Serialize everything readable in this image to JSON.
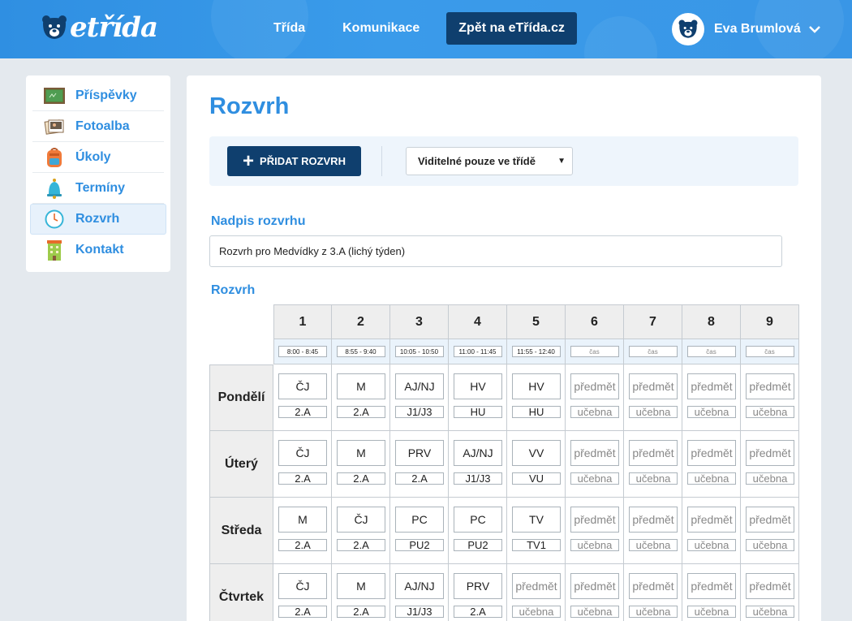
{
  "brand": {
    "logo_text": "etřída"
  },
  "nav": {
    "items": [
      "Třída",
      "Komunikace"
    ],
    "back_label": "Zpět na eTřída.cz"
  },
  "user": {
    "name": "Eva Brumlová"
  },
  "sidebar": {
    "items": [
      {
        "label": "Příspěvky",
        "icon": "board-icon"
      },
      {
        "label": "Fotoalba",
        "icon": "photo-album-icon"
      },
      {
        "label": "Úkoly",
        "icon": "backpack-icon"
      },
      {
        "label": "Termíny",
        "icon": "bell-icon"
      },
      {
        "label": "Rozvrh",
        "icon": "clock-icon",
        "active": true
      },
      {
        "label": "Kontakt",
        "icon": "building-icon"
      }
    ]
  },
  "page": {
    "title": "Rozvrh",
    "add_button": "PŘIDAT ROZVRH",
    "visibility_select": "Viditelné pouze ve třídě",
    "name_label": "Nadpis rozvrhu",
    "name_value": "Rozvrh pro Medvídky z 3.A (lichý týden)",
    "grid_label": "Rozvrh"
  },
  "schedule": {
    "columns": [
      "1",
      "2",
      "3",
      "4",
      "5",
      "6",
      "7",
      "8",
      "9"
    ],
    "times": [
      "8:00 - 8:45",
      "8:55 - 9:40",
      "10:05 - 10:50",
      "11:00 - 11:45",
      "11:55 - 12:40",
      "",
      "",
      "",
      ""
    ],
    "time_placeholder": "čas",
    "subject_placeholder": "předmět",
    "room_placeholder": "učebna",
    "days": [
      {
        "name": "Pondělí",
        "cells": [
          [
            "ČJ",
            "2.A"
          ],
          [
            "M",
            "2.A"
          ],
          [
            "AJ/NJ",
            "J1/J3"
          ],
          [
            "HV",
            "HU"
          ],
          [
            "HV",
            "HU"
          ],
          [
            "",
            ""
          ],
          [
            "",
            ""
          ],
          [
            "",
            ""
          ],
          [
            "",
            ""
          ]
        ]
      },
      {
        "name": "Úterý",
        "cells": [
          [
            "ČJ",
            "2.A"
          ],
          [
            "M",
            "2.A"
          ],
          [
            "PRV",
            "2.A"
          ],
          [
            "AJ/NJ",
            "J1/J3"
          ],
          [
            "VV",
            "VU"
          ],
          [
            "",
            ""
          ],
          [
            "",
            ""
          ],
          [
            "",
            ""
          ],
          [
            "",
            ""
          ]
        ]
      },
      {
        "name": "Středa",
        "cells": [
          [
            "M",
            "2.A"
          ],
          [
            "ČJ",
            "2.A"
          ],
          [
            "PC",
            "PU2"
          ],
          [
            "PC",
            "PU2"
          ],
          [
            "TV",
            "TV1"
          ],
          [
            "",
            ""
          ],
          [
            "",
            ""
          ],
          [
            "",
            ""
          ],
          [
            "",
            ""
          ]
        ]
      },
      {
        "name": "Čtvrtek",
        "cells": [
          [
            "ČJ",
            "2.A"
          ],
          [
            "M",
            "2.A"
          ],
          [
            "AJ/NJ",
            "J1/J3"
          ],
          [
            "PRV",
            "2.A"
          ],
          [
            "",
            ""
          ],
          [
            "",
            ""
          ],
          [
            "",
            ""
          ],
          [
            "",
            ""
          ],
          [
            "",
            ""
          ]
        ]
      }
    ]
  }
}
